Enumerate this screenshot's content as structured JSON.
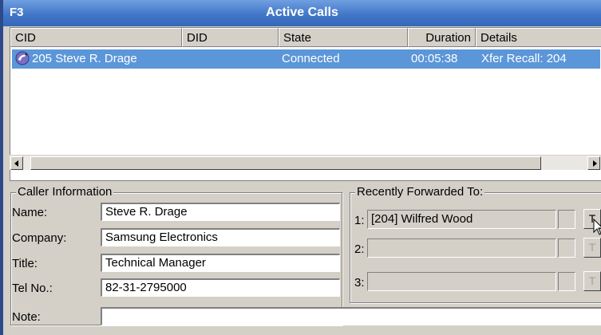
{
  "window": {
    "hotkey": "F3",
    "title": "Active Calls"
  },
  "calls_list": {
    "columns": [
      "CID",
      "DID",
      "State",
      "Duration",
      "Details"
    ],
    "rows": [
      {
        "cid": "205 Steve R. Drage",
        "did": "",
        "state": "Connected",
        "duration": "00:05:38",
        "details": "Xfer Recall: 204",
        "icon": "phone-call-icon",
        "selected": true
      }
    ]
  },
  "caller_info": {
    "legend": "Caller Information",
    "name_label": "Name:",
    "name_value": "Steve R. Drage",
    "company_label": "Company:",
    "company_value": "Samsung Electronics",
    "title_label": "Title:",
    "title_value": "Technical Manager",
    "tel_label": "Tel No.:",
    "tel_value": "82-31-2795000",
    "note_label": "Note:",
    "note_value": ""
  },
  "recently_forwarded": {
    "legend": "Recently Forwarded To:",
    "entries": [
      {
        "num": "1:",
        "value": "[204] Wilfred Wood",
        "button": "T",
        "enabled": true
      },
      {
        "num": "2:",
        "value": "",
        "button": "T",
        "enabled": false
      },
      {
        "num": "3:",
        "value": "",
        "button": "T",
        "enabled": false
      }
    ]
  },
  "colors": {
    "titlebar": "#3f74c6",
    "selection": "#5b96d9",
    "window_bg": "#d4d0c8"
  }
}
